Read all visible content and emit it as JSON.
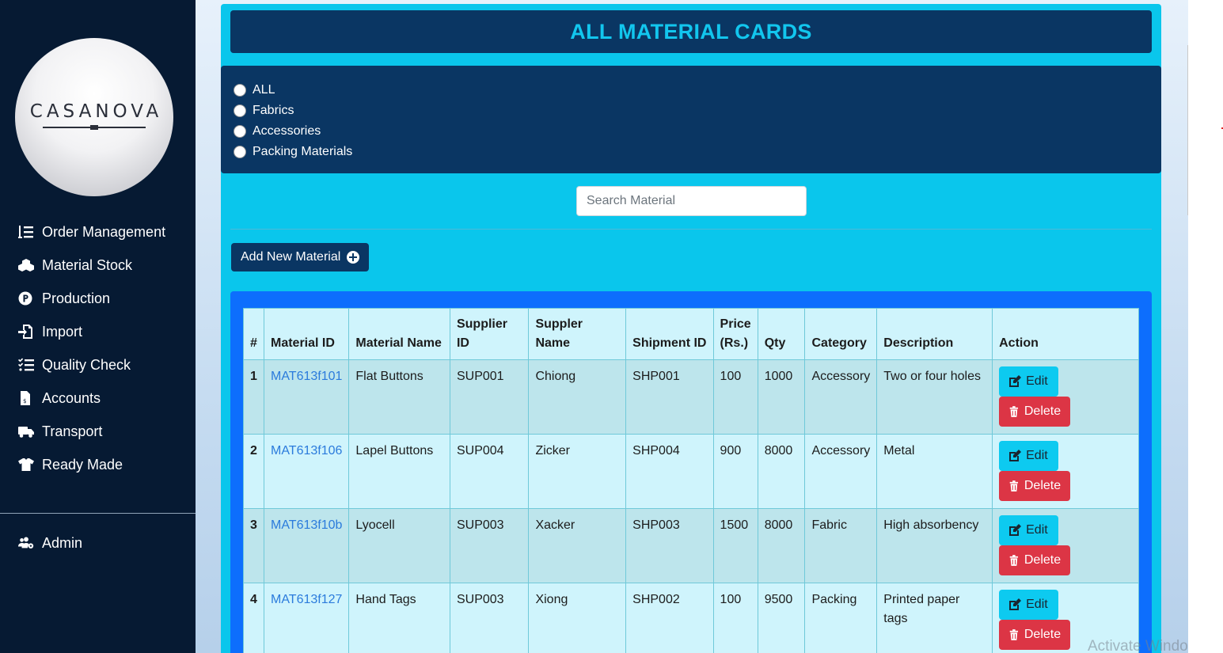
{
  "brand": {
    "logo_text": "CASANOVA"
  },
  "sidebar": {
    "items": [
      {
        "label": "Order Management",
        "icon": "list-ordered-icon"
      },
      {
        "label": "Material Stock",
        "icon": "cubes-icon"
      },
      {
        "label": "Production",
        "icon": "product-p-icon"
      },
      {
        "label": "Import",
        "icon": "file-import-icon"
      },
      {
        "label": "Quality Check",
        "icon": "checklist-icon"
      },
      {
        "label": "Accounts",
        "icon": "invoice-icon"
      },
      {
        "label": "Transport",
        "icon": "truck-icon"
      },
      {
        "label": "Ready Made",
        "icon": "tshirt-icon"
      }
    ],
    "admin": {
      "label": "Admin",
      "icon": "users-cog-icon"
    }
  },
  "header": {
    "title": "ALL MATERIAL CARDS"
  },
  "filters": {
    "options": [
      "ALL",
      "Fabrics",
      "Accessories",
      "Packing Materials"
    ]
  },
  "search": {
    "placeholder": "Search Material",
    "value": ""
  },
  "toolbar": {
    "add_label": "Add New Material"
  },
  "table": {
    "headers": {
      "num": "#",
      "material_id": "Material ID",
      "material_name": "Material Name",
      "supplier_id": "Supplier ID",
      "supplier_name": "Suppler Name",
      "shipment_id": "Shipment ID",
      "price": "Price (Rs.)",
      "qty": "Qty",
      "category": "Category",
      "description": "Description",
      "action": "Action"
    },
    "rows": [
      {
        "num": "1",
        "material_id": "MAT613f101",
        "material_name": "Flat Buttons",
        "supplier_id": "SUP001",
        "supplier_name": "Chiong",
        "shipment_id": "SHP001",
        "price": "100",
        "qty": "1000",
        "category": "Accessory",
        "description": "Two or four holes"
      },
      {
        "num": "2",
        "material_id": "MAT613f106",
        "material_name": "Lapel Buttons",
        "supplier_id": "SUP004",
        "supplier_name": "Zicker",
        "shipment_id": "SHP004",
        "price": "900",
        "qty": "8000",
        "category": "Accessory",
        "description": "Metal"
      },
      {
        "num": "3",
        "material_id": "MAT613f10b",
        "material_name": "Lyocell",
        "supplier_id": "SUP003",
        "supplier_name": "Xacker",
        "shipment_id": "SHP003",
        "price": "1500",
        "qty": "8000",
        "category": "Fabric",
        "description": "High absorbency"
      },
      {
        "num": "4",
        "material_id": "MAT613f127",
        "material_name": "Hand Tags",
        "supplier_id": "SUP003",
        "supplier_name": "Xiong",
        "shipment_id": "SHP002",
        "price": "100",
        "qty": "9500",
        "category": "Packing",
        "description": "Printed paper tags"
      }
    ],
    "edit_label": "Edit",
    "delete_label": "Delete"
  },
  "watermark": "Activate Windo",
  "colors": {
    "sidebar_bg": "#061a33",
    "accent_cyan": "#0ac6ec",
    "navy": "#0a3663",
    "table_border_blue": "#0d6efd",
    "delete_red": "#dc3545",
    "link_blue": "#2b7bdc"
  }
}
